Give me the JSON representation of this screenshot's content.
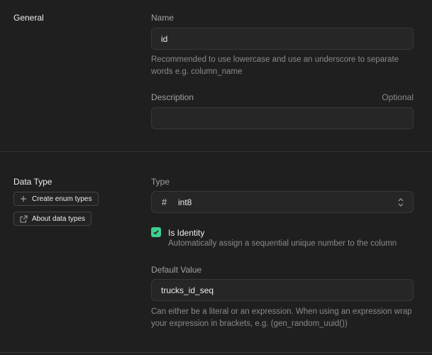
{
  "general": {
    "section_title": "General",
    "name_label": "Name",
    "name_value": "id",
    "name_help": "Recommended to use lowercase and use an underscore to separate words e.g. column_name",
    "description_label": "Description",
    "description_optional": "Optional",
    "description_value": ""
  },
  "data_type": {
    "section_title": "Data Type",
    "create_enum_button": "Create enum types",
    "about_types_button": "About data types",
    "type_label": "Type",
    "type_icon": "#",
    "type_value": "int8",
    "identity_label": "Is Identity",
    "identity_checked": true,
    "identity_desc": "Automatically assign a sequential unique number to the column",
    "default_label": "Default Value",
    "default_value": "trucks_id_seq",
    "default_help": "Can either be a literal or an expression. When using an expression wrap your expression in brackets, e.g. (gen_random_uuid())"
  },
  "colors": {
    "background": "#1f1f1f",
    "accent": "#3ecf8e"
  }
}
